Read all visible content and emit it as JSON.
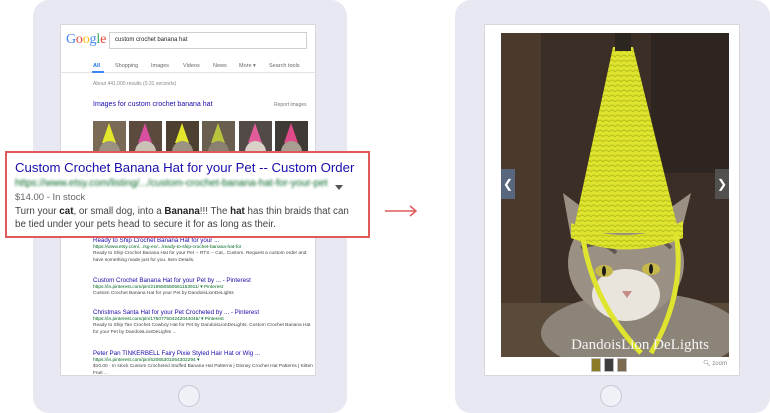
{
  "colors": {
    "accent_link": "#1a0dab",
    "url_green": "#006621",
    "highlight_border": "#e05a5a",
    "hat_yellow": "#dfe42e"
  },
  "google": {
    "logo_letters": [
      {
        "ch": "G",
        "color": "#4285f4"
      },
      {
        "ch": "o",
        "color": "#ea4335"
      },
      {
        "ch": "o",
        "color": "#fbbc05"
      },
      {
        "ch": "g",
        "color": "#4285f4"
      },
      {
        "ch": "l",
        "color": "#34a853"
      },
      {
        "ch": "e",
        "color": "#ea4335"
      }
    ],
    "search_query": "custom crochet banana hat",
    "tabs": [
      "All",
      "Shopping",
      "Images",
      "Videos",
      "News",
      "More ▾",
      "Search tools"
    ],
    "results_count": "About 441,000 results (0.31 seconds)",
    "images_title": "Images for custom crochet banana hat",
    "report_images": "Report images",
    "results": [
      {
        "title": "Ready to Ship Crochet Banana Hat for your ...",
        "url": "https://www.etsy.com/.../sg-en/.../ready-to-ship-crochet-banana-hat-for",
        "desc": "Ready to Ship Crochet Banana Hat for your Pet -- RTS -- Cat,. Custom. Request a custom order and have something made just for you. Item Details."
      },
      {
        "title": "Custom Crochet Banana Hat for your Pet by ... - Pinterest",
        "url": "https://in.pinterest.com/pin/219550550561153911/ ▾ Pinterest",
        "desc": "Custom Crochet Banana Hat for your Pet by DandoisLionDeLights"
      },
      {
        "title": "Christmas Santa Hat for your Pet Crocheted by ... - Pinterest",
        "url": "https://in.pinterest.com/pin/175077504242044045/ ▾ Pinterest",
        "desc": "Ready to Ship Tan Crochet Cowboy Hat for Pet by DandoisLionDeLights. Custom Crochet Banana Hat for your Pet by DandoisLionDeLights ..."
      },
      {
        "title": "Peter Pan TINKERBELL Fairy Pixie Styled Hair Hat or Wig ...",
        "url": "https://in.pinterest.com/pin/62065301064302294 ▾",
        "desc": "$10.00 · In stock Custom Crocheted Stuffed Banana Hat Patterns | Disney Crochet Hat Patterns | Kitten Fruit ..."
      }
    ]
  },
  "card": {
    "title": "Custom Crochet Banana Hat for your Pet -- Custom Order",
    "url": "https://www.etsy.com/listing/.../custom-crochet-banana-hat-for-your-pet",
    "price": "$14.00 - In stock",
    "desc_parts": [
      {
        "t": "Turn your ",
        "b": false
      },
      {
        "t": "cat",
        "b": true
      },
      {
        "t": ", or small dog, into a ",
        "b": false
      },
      {
        "t": "Banana",
        "b": true
      },
      {
        "t": "!!! The ",
        "b": false
      },
      {
        "t": "hat",
        "b": true
      },
      {
        "t": " has thin braids that can be tied under your pets head to secure it for as long as their.",
        "b": false
      }
    ]
  },
  "viewer": {
    "watermark": "DandoisLion DeLights",
    "prev_icon": "❮",
    "next_icon": "❯",
    "zoom_label": "zoom",
    "thumb_colors": [
      "#8c7c2a",
      "#3d3d3d",
      "#7c6a50"
    ]
  }
}
